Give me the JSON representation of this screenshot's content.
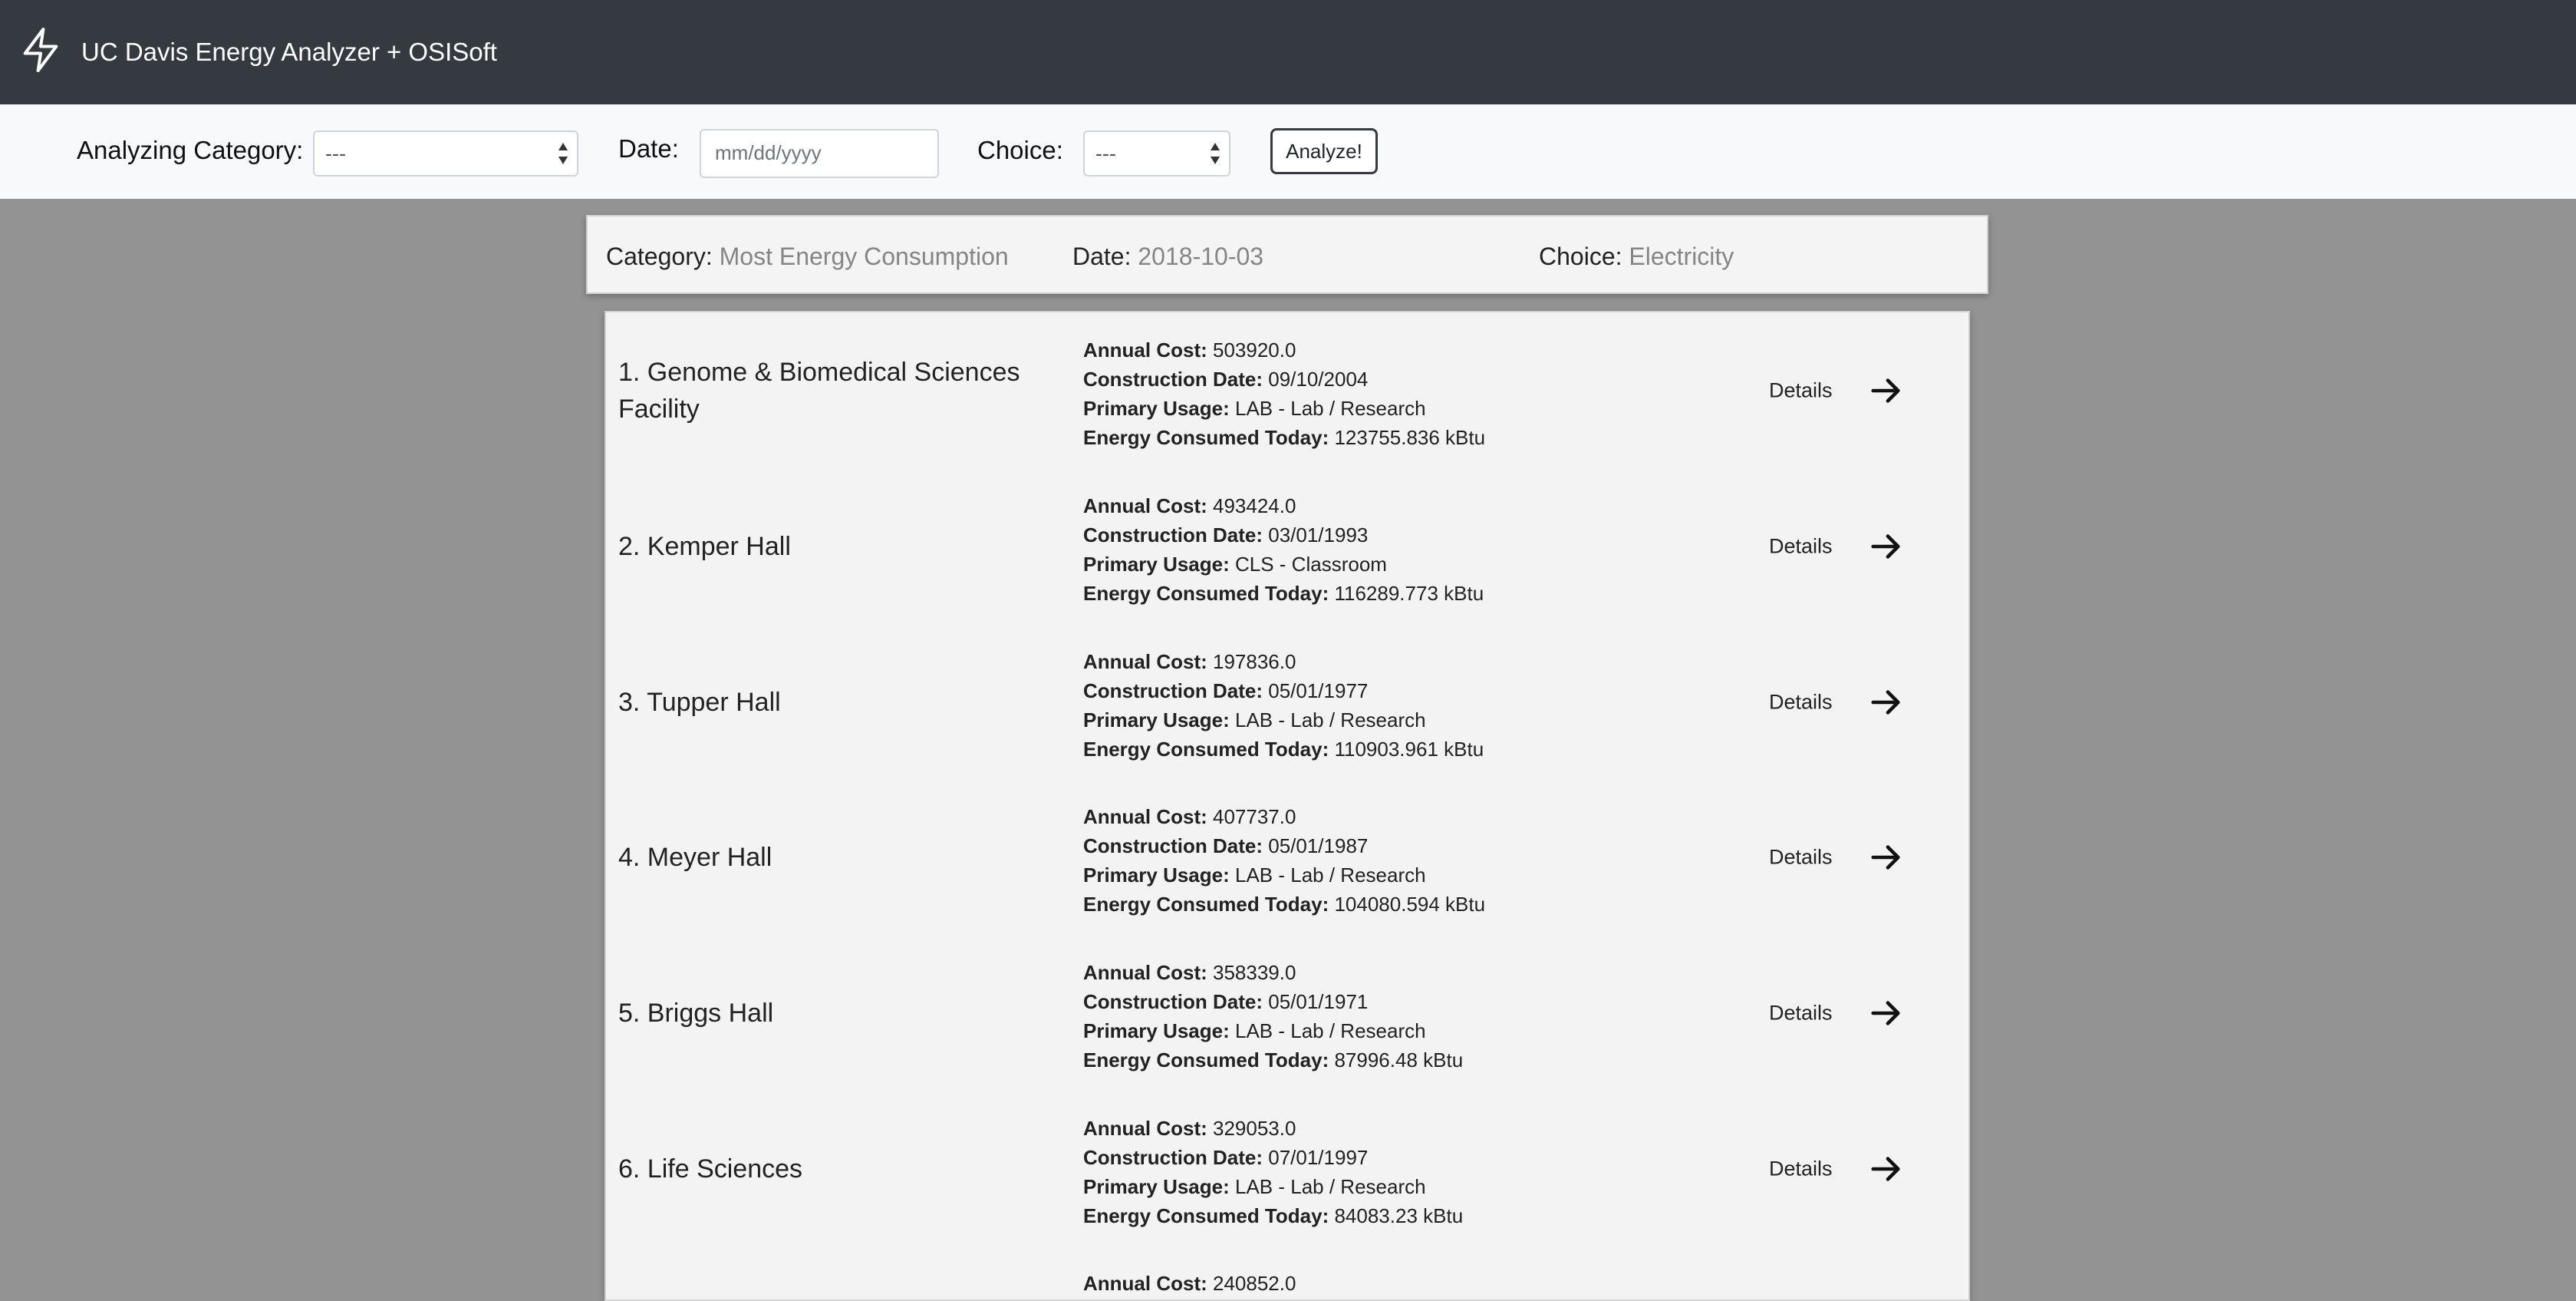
{
  "navbar": {
    "brand": "UC Davis Energy Analyzer + OSISoft",
    "icon": "lightning-bolt-icon"
  },
  "form": {
    "category_label": "Analyzing Category:",
    "category_value": "---",
    "date_label": "Date:",
    "date_placeholder": "mm/dd/yyyy",
    "choice_label": "Choice:",
    "choice_value": "---",
    "analyze_label": "Analyze!"
  },
  "summary": {
    "category_key": "Category:",
    "category_value": "Most Energy Consumption",
    "date_key": "Date:",
    "date_value": "2018-10-03",
    "choice_key": "Choice:",
    "choice_value": "Electricity"
  },
  "field_labels": {
    "annual_cost": "Annual Cost:",
    "construction_date": "Construction Date:",
    "primary_usage": "Primary Usage:",
    "energy_today": "Energy Consumed Today:"
  },
  "details_label": "Details",
  "buildings": [
    {
      "name": "1. Genome & Biomedical Sciences Facility",
      "annual_cost": "503920.0",
      "construction_date": "09/10/2004",
      "primary_usage": "LAB - Lab / Research",
      "energy_today": "123755.836 kBtu"
    },
    {
      "name": "2. Kemper Hall",
      "annual_cost": "493424.0",
      "construction_date": "03/01/1993",
      "primary_usage": "CLS - Classroom",
      "energy_today": "116289.773 kBtu"
    },
    {
      "name": "3. Tupper Hall",
      "annual_cost": "197836.0",
      "construction_date": "05/01/1977",
      "primary_usage": "LAB - Lab / Research",
      "energy_today": "110903.961 kBtu"
    },
    {
      "name": "4. Meyer Hall",
      "annual_cost": "407737.0",
      "construction_date": "05/01/1987",
      "primary_usage": "LAB - Lab / Research",
      "energy_today": "104080.594 kBtu"
    },
    {
      "name": "5. Briggs Hall",
      "annual_cost": "358339.0",
      "construction_date": "05/01/1971",
      "primary_usage": "LAB - Lab / Research",
      "energy_today": "87996.48 kBtu"
    },
    {
      "name": "6. Life Sciences",
      "annual_cost": "329053.0",
      "construction_date": "07/01/1997",
      "primary_usage": "LAB - Lab / Research",
      "energy_today": "84083.23 kBtu"
    },
    {
      "annual_cost": "240852.0"
    }
  ]
}
